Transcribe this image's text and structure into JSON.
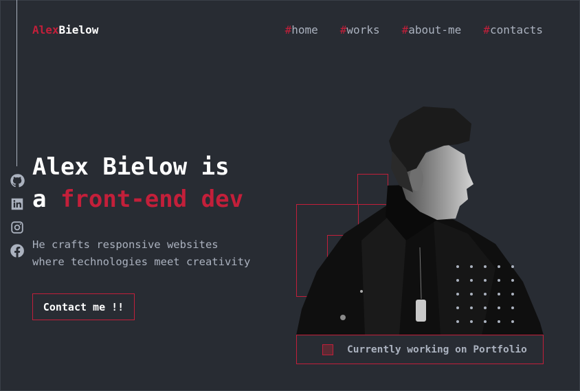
{
  "header": {
    "logo_accent": "Alex",
    "logo_rest": "Bielow",
    "nav": [
      {
        "hash": "#",
        "label": "home"
      },
      {
        "hash": "#",
        "label": "works"
      },
      {
        "hash": "#",
        "label": "about-me"
      },
      {
        "hash": "#",
        "label": "contacts"
      }
    ]
  },
  "socials": [
    "github-icon",
    "linkedin-icon",
    "instagram-icon",
    "facebook-icon"
  ],
  "hero": {
    "line1": "Alex Bielow is",
    "line2_prefix": "a ",
    "line2_highlight": "front-end dev",
    "sub1": "He crafts responsive websites",
    "sub2": "where technologies meet creativity",
    "cta": "Contact me !!"
  },
  "status": {
    "text": "Currently working on Portfolio"
  },
  "colors": {
    "background": "#282c33",
    "accent": "#c31f3a",
    "muted": "#abb2bf"
  }
}
